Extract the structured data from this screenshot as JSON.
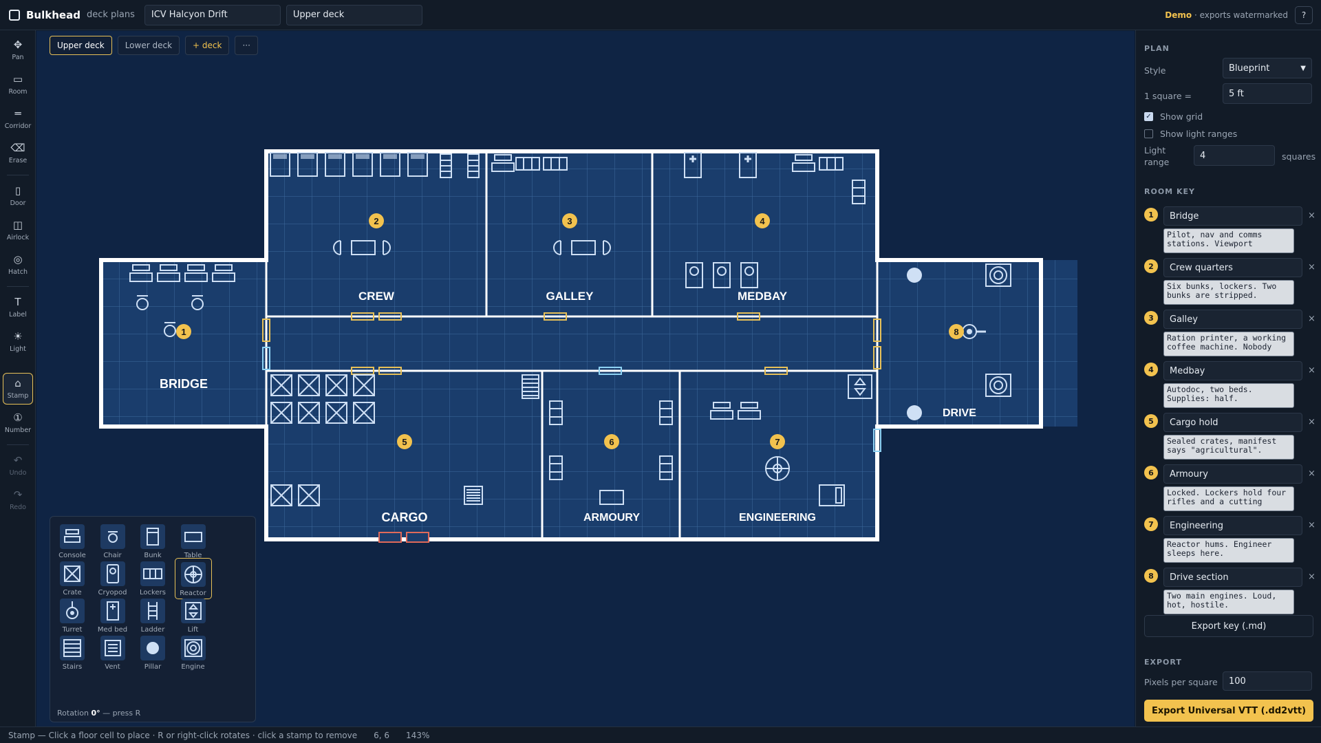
{
  "app": {
    "name": "Bulkhead",
    "subtitle": "deck plans",
    "ship_name": "ICV Halcyon Drift",
    "deck_name": "Upper deck",
    "demo_label": "Demo",
    "demo_note": " · exports watermarked",
    "help_label": "?"
  },
  "tools": [
    {
      "label": "Pan",
      "icon": "✥",
      "icon_name": "pan-icon"
    },
    {
      "label": "Room",
      "icon": "▭",
      "icon_name": "room-icon"
    },
    {
      "label": "Corridor",
      "icon": "═",
      "icon_name": "corridor-icon"
    },
    {
      "label": "Erase",
      "icon": "⌫",
      "icon_name": "erase-icon"
    },
    {
      "label": "Door",
      "icon": "▯",
      "icon_name": "door-icon"
    },
    {
      "label": "Airlock",
      "icon": "◫",
      "icon_name": "airlock-icon"
    },
    {
      "label": "Hatch",
      "icon": "◎",
      "icon_name": "hatch-icon"
    },
    {
      "label": "Label",
      "icon": "T",
      "icon_name": "label-icon"
    },
    {
      "label": "Light",
      "icon": "☀",
      "icon_name": "light-icon"
    },
    {
      "label": "Stamp",
      "icon": "⌂",
      "icon_name": "stamp-icon"
    },
    {
      "label": "Number",
      "icon": "①",
      "icon_name": "number-icon"
    },
    {
      "label": "Undo",
      "icon": "↶",
      "icon_name": "undo-icon"
    },
    {
      "label": "Redo",
      "icon": "↷",
      "icon_name": "redo-icon"
    }
  ],
  "deck_tabs": [
    {
      "label": "Upper deck",
      "active": true
    },
    {
      "label": "Lower deck",
      "active": false
    },
    {
      "label": "+ deck",
      "active": false
    },
    {
      "label": "···",
      "active": false
    }
  ],
  "map": {
    "rooms": [
      {
        "number": "1",
        "name": "BRIDGE"
      },
      {
        "number": "2",
        "name": "CREW"
      },
      {
        "number": "3",
        "name": "GALLEY"
      },
      {
        "number": "4",
        "name": "MEDBAY"
      },
      {
        "number": "5",
        "name": "CARGO"
      },
      {
        "number": "6",
        "name": "ARMOURY"
      },
      {
        "number": "7",
        "name": "ENGINEERING"
      },
      {
        "number": "8",
        "name": "DRIVE"
      }
    ]
  },
  "palette": {
    "items": [
      {
        "label": "Console",
        "icon_name": "console-icon"
      },
      {
        "label": "Chair",
        "icon_name": "chair-icon"
      },
      {
        "label": "Bunk",
        "icon_name": "bunk-icon"
      },
      {
        "label": "Table",
        "icon_name": "table-icon"
      },
      {
        "label": "Crate",
        "icon_name": "crate-icon"
      },
      {
        "label": "Cryopod",
        "icon_name": "cryopod-icon"
      },
      {
        "label": "Lockers",
        "icon_name": "lockers-icon"
      },
      {
        "label": "Reactor",
        "icon_name": "reactor-icon"
      },
      {
        "label": "Turret",
        "icon_name": "turret-icon"
      },
      {
        "label": "Med bed",
        "icon_name": "med-bed-icon"
      },
      {
        "label": "Ladder",
        "icon_name": "ladder-icon"
      },
      {
        "label": "Lift",
        "icon_name": "lift-icon"
      },
      {
        "label": "Stairs",
        "icon_name": "stairs-icon"
      },
      {
        "label": "Vent",
        "icon_name": "vent-icon"
      },
      {
        "label": "Pillar",
        "icon_name": "pillar-icon"
      },
      {
        "label": "Engine",
        "icon_name": "engine-icon"
      }
    ],
    "selected": "Reactor",
    "rotation_prefix": "Rotation ",
    "rotation_value": "0°",
    "rotation_suffix": " — press R"
  },
  "panel": {
    "plan_title": "PLAN",
    "style_label": "Style",
    "style_value": "Blueprint",
    "square_label": "1 square =",
    "square_value": "5 ft",
    "show_grid_label": "Show grid",
    "show_grid": true,
    "show_light_label": "Show light ranges",
    "show_light": false,
    "light_range_label": "Light range",
    "light_range_value": "4",
    "light_range_unit": "squares",
    "room_key_title": "ROOM KEY",
    "room_key": [
      {
        "number": "1",
        "name": "Bridge",
        "notes": "Pilot, nav and comms stations. Viewport"
      },
      {
        "number": "2",
        "name": "Crew quarters",
        "notes": "Six bunks, lockers. Two bunks are stripped."
      },
      {
        "number": "3",
        "name": "Galley",
        "notes": "Ration printer, a working coffee machine. Nobody"
      },
      {
        "number": "4",
        "name": "Medbay",
        "notes": "Autodoc, two beds. Supplies: half."
      },
      {
        "number": "5",
        "name": "Cargo hold",
        "notes": "Sealed crates, manifest says \"agricultural\"."
      },
      {
        "number": "6",
        "name": "Armoury",
        "notes": "Locked. Lockers hold four rifles and a cutting"
      },
      {
        "number": "7",
        "name": "Engineering",
        "notes": "Reactor hums. Engineer sleeps here."
      },
      {
        "number": "8",
        "name": "Drive section",
        "notes": "Two main engines. Loud, hot, hostile."
      }
    ],
    "remove_label": "×",
    "export_key_label": "Export key (.md)",
    "export_title": "EXPORT",
    "pps_label": "Pixels per square",
    "pps_value": "100",
    "export_vtt_label": "Export Universal VTT (.dd2vtt)"
  },
  "status": {
    "hint": "Stamp — Click a floor cell to place · R or right-click rotates · click a stamp to remove",
    "coords": "6, 6",
    "zoom": "143%"
  },
  "colors": {
    "accent": "#f2c24e",
    "blueprint_bg": "#0f2444",
    "floor": "#1a3d6c",
    "wall": "#ffffff",
    "door": "#e8c158",
    "airlock": "#8fd3f4",
    "hatch_red": "#e06a5a"
  }
}
